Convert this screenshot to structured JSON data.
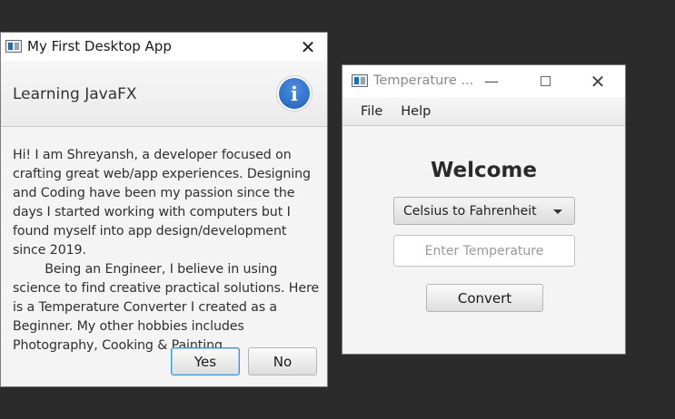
{
  "dialog": {
    "title": "My First Desktop App",
    "close_label": "✕",
    "header_text": "Learning JavaFX",
    "info_glyph": "i",
    "content": "Hi! I am Shreyansh, a developer focused on crafting great web/app experiences. Designing and Coding have been my passion since the days I started working with computers but I found myself into app design/development since 2019.\n        Being an Engineer, I believe in using science to find creative practical solutions. Here is a Temperature Converter I created as a Beginner. My other hobbies includes Photography, Cooking & Painting.",
    "yes_label": "Yes",
    "no_label": "No"
  },
  "temp_window": {
    "title": "Temperature ...",
    "minimize_label": "—",
    "close_label": "✕",
    "menu": [
      {
        "label": "File"
      },
      {
        "label": "Help"
      }
    ],
    "welcome": "Welcome",
    "conversion_selected": "Celsius to Fahrenheit",
    "input_value": "",
    "input_placeholder": "Enter Temperature",
    "convert_label": "Convert"
  },
  "icons": {
    "dialog_info": "info-icon",
    "app": "app-icon",
    "dropdown": "chevron-down-icon"
  },
  "colors": {
    "desktop_bg": "#2b2b2b",
    "info_blue": "#2f72d2",
    "default_button_border": "#3c8ee0"
  }
}
